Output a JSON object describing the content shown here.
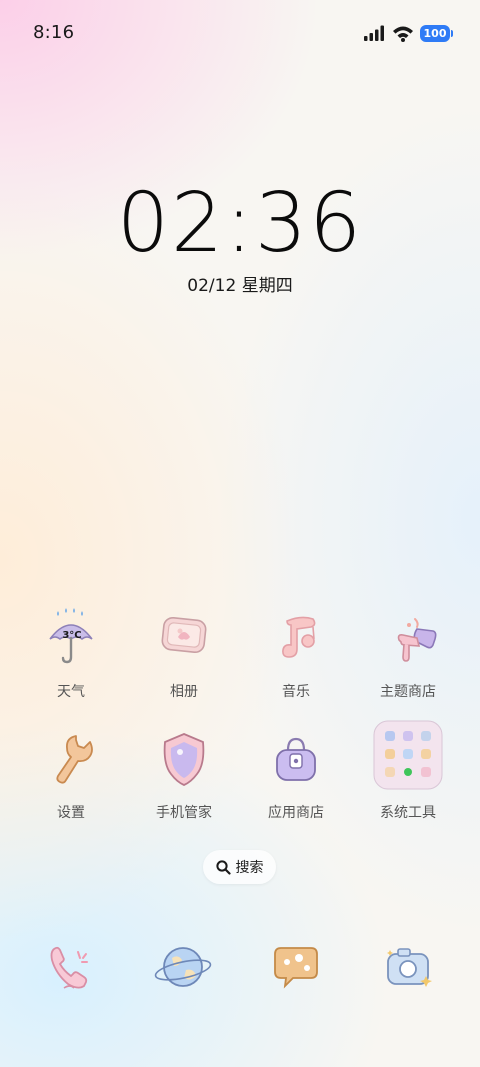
{
  "status_bar": {
    "time": "8:16",
    "battery": "100",
    "icons": [
      "signal-icon",
      "wifi-icon",
      "battery-icon"
    ]
  },
  "lockscreen": {
    "clock": "02:36",
    "date": "02/12 星期四"
  },
  "apps": [
    {
      "label": "天气",
      "icon": "umbrella-weather-icon",
      "badge": "3°C"
    },
    {
      "label": "相册",
      "icon": "photo-frame-icon"
    },
    {
      "label": "音乐",
      "icon": "music-note-icon"
    },
    {
      "label": "主题商店",
      "icon": "paint-brush-icon"
    },
    {
      "label": "设置",
      "icon": "wrench-icon"
    },
    {
      "label": "手机管家",
      "icon": "shield-icon"
    },
    {
      "label": "应用商店",
      "icon": "shopping-bag-icon"
    },
    {
      "label": "系统工具",
      "icon": "folder-icon"
    }
  ],
  "search": {
    "label": "搜索"
  },
  "dock": [
    {
      "icon": "phone-icon"
    },
    {
      "icon": "globe-browser-icon"
    },
    {
      "icon": "message-bubble-icon"
    },
    {
      "icon": "camera-icon"
    }
  ],
  "colors": {
    "battery": "#2f7bf6",
    "accent_pink": "#f4a9c7",
    "accent_purple": "#b8a6e6",
    "accent_orange": "#e9b06a"
  }
}
